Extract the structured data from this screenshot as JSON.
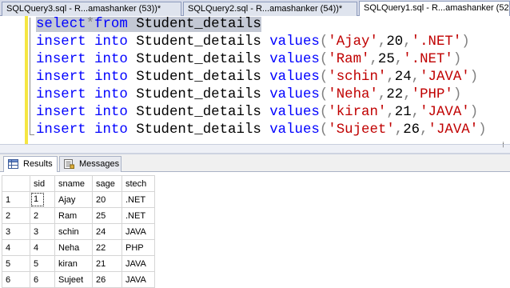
{
  "tabs": [
    {
      "label": "SQLQuery3.sql - R...amashanker (53))*",
      "active": false
    },
    {
      "label": "SQLQuery2.sql - R...amashanker (54))*",
      "active": false
    },
    {
      "label": "SQLQuery1.sql - R...amashanker (52))*",
      "active": true
    }
  ],
  "close_glyph": "×",
  "editor": {
    "selected_line": {
      "kw1": "select",
      "star": "*",
      "kw2": "from",
      "table": " Student_details"
    },
    "insert_kw": "insert",
    "into_kw": "into",
    "table_name": "Student_details",
    "values_kw": "values",
    "rows": [
      {
        "name": "'Ajay'",
        "age": "20",
        "tech": "'.NET'"
      },
      {
        "name": "'Ram'",
        "age": "25",
        "tech": "'.NET'"
      },
      {
        "name": "'schin'",
        "age": "24",
        "tech": "'JAVA'"
      },
      {
        "name": "'Neha'",
        "age": "22",
        "tech": "'PHP'"
      },
      {
        "name": "'kiran'",
        "age": "21",
        "tech": "'JAVA'"
      },
      {
        "name": "'Sujeet'",
        "age": "26",
        "tech": "'JAVA'"
      }
    ]
  },
  "results_tabs": [
    {
      "label": "Results",
      "icon": "grid-icon",
      "active": true
    },
    {
      "label": "Messages",
      "icon": "messages-icon",
      "active": false
    }
  ],
  "grid": {
    "columns": [
      "sid",
      "sname",
      "sage",
      "stech"
    ],
    "rows": [
      {
        "row": "1",
        "sid": "1",
        "sname": "Ajay",
        "sage": "20",
        "stech": ".NET"
      },
      {
        "row": "2",
        "sid": "2",
        "sname": "Ram",
        "sage": "25",
        "stech": ".NET"
      },
      {
        "row": "3",
        "sid": "3",
        "sname": "schin",
        "sage": "24",
        "stech": "JAVA"
      },
      {
        "row": "4",
        "sid": "4",
        "sname": "Neha",
        "sage": "22",
        "stech": "PHP"
      },
      {
        "row": "5",
        "sid": "5",
        "sname": "kiran",
        "sage": "21",
        "stech": "JAVA"
      },
      {
        "row": "6",
        "sid": "6",
        "sname": "Sujeet",
        "sage": "26",
        "stech": "JAVA"
      }
    ]
  },
  "colors": {
    "keyword": "#0000ff",
    "string": "#c00000",
    "selection": "#c3c8d4",
    "change_bar": "#f5e642"
  }
}
